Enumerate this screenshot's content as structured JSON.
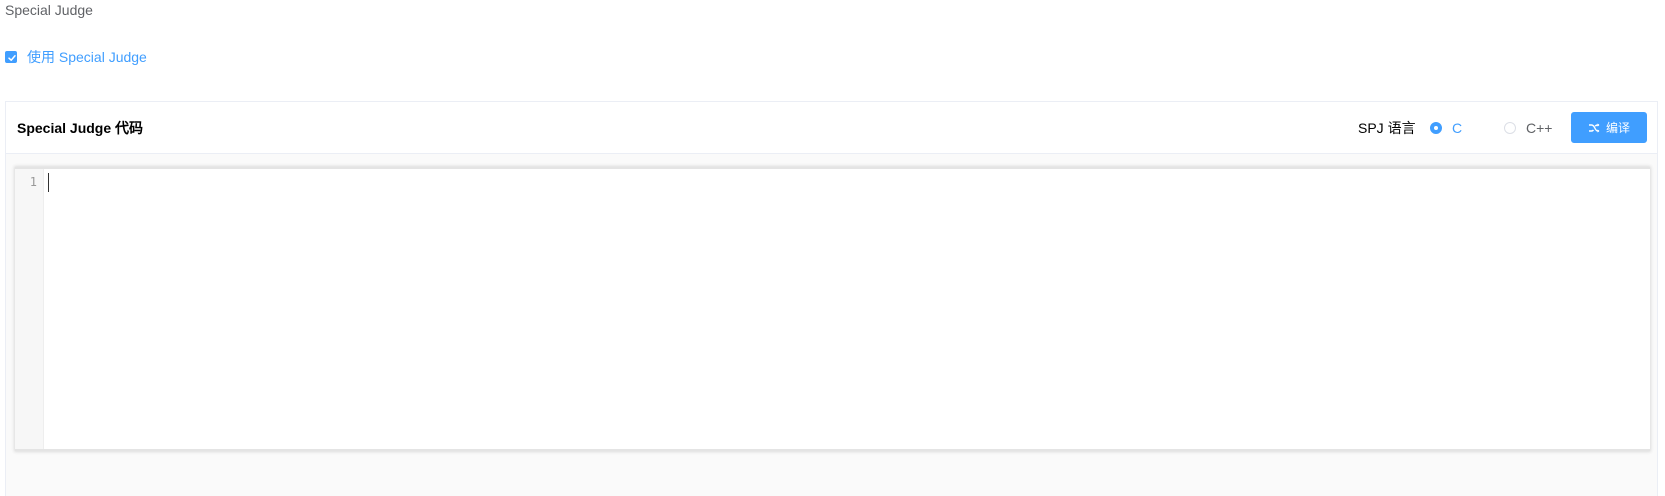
{
  "section": {
    "label": "Special Judge"
  },
  "spj_toggle": {
    "label": "使用 Special Judge",
    "checked": true
  },
  "card": {
    "title": "Special Judge 代码",
    "language_label": "SPJ 语言",
    "languages": [
      {
        "label": "C",
        "selected": true
      },
      {
        "label": "C++",
        "selected": false
      }
    ],
    "compile_button": {
      "label": "编译",
      "icon": "shuffle-icon"
    }
  },
  "editor": {
    "line_numbers": [
      "1"
    ],
    "content": ""
  },
  "colors": {
    "accent": "#409eff",
    "border": "#ebeef5",
    "text": "#606266"
  }
}
